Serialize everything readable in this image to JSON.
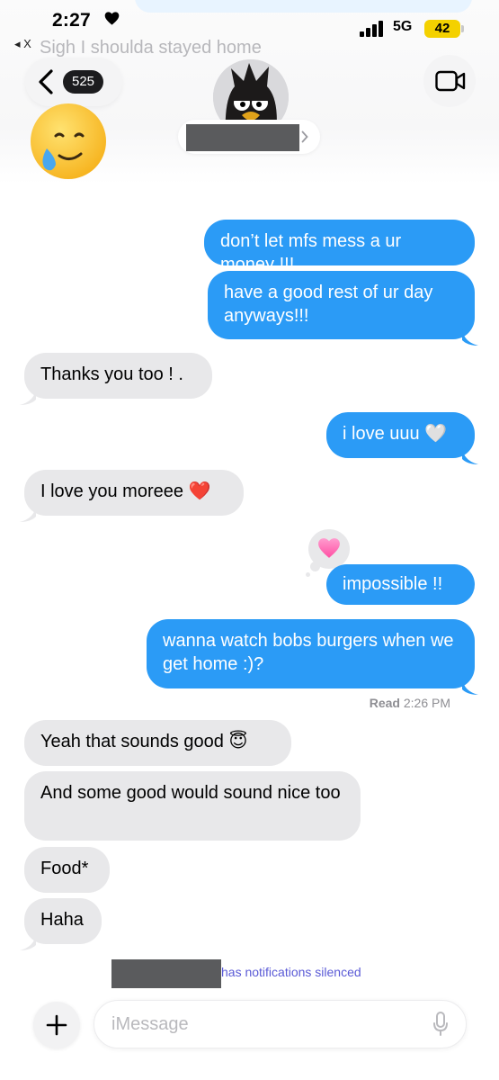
{
  "status_bar": {
    "time": "2:27",
    "network": "5G",
    "battery": "42"
  },
  "back_app": {
    "label": "◂ X",
    "preview": "Sigh I shoulda stayed home"
  },
  "header": {
    "unread_count": "525"
  },
  "messages": [
    {
      "text": "don’t let mfs mess a ur money !!!",
      "direction": "sent"
    },
    {
      "text": "have a good rest of ur day anyways!!!",
      "direction": "sent"
    },
    {
      "text": "Thanks you too ! .",
      "direction": "received"
    },
    {
      "text": "i love uuu",
      "emoji": "🤍",
      "direction": "sent"
    },
    {
      "text": "I love you moreee",
      "emoji": "❤️",
      "direction": "received"
    },
    {
      "text": "impossible !!",
      "direction": "sent",
      "tapback": "pink-heart"
    },
    {
      "text": "wanna watch bobs burgers when we get home :)?",
      "direction": "sent"
    },
    {
      "text": "Yeah that sounds good",
      "emoji": "😇",
      "direction": "received"
    },
    {
      "text": "And some good would sound nice too",
      "direction": "received"
    },
    {
      "text": "Food*",
      "direction": "received"
    },
    {
      "text": "Haha",
      "direction": "received"
    }
  ],
  "read_receipt": {
    "label": "Read",
    "time": "2:26 PM"
  },
  "notification_notice": "has notifications silenced",
  "composer": {
    "placeholder": "iMessage"
  },
  "colors": {
    "sent_bubble": "#2b9bf6",
    "received_bubble": "#e8e8ea",
    "battery": "#f4d100"
  }
}
